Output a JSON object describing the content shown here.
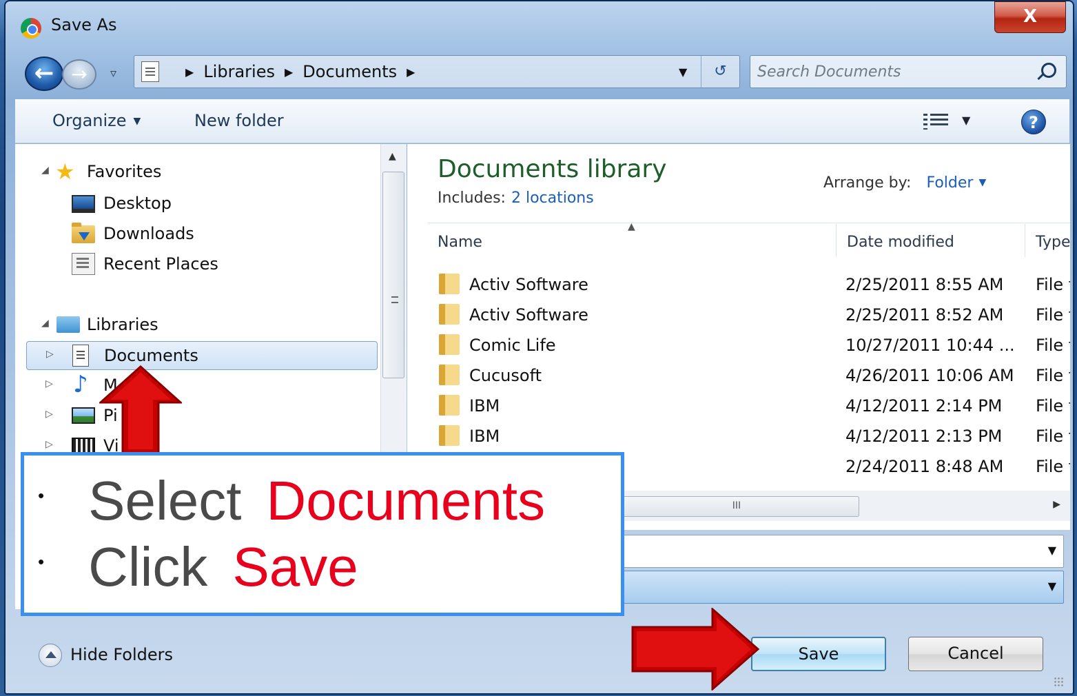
{
  "window": {
    "title": "Save As",
    "close_label": "X"
  },
  "address": {
    "crumbs": [
      "Libraries",
      "Documents"
    ],
    "search_placeholder": "Search Documents"
  },
  "toolbar": {
    "organize": "Organize",
    "new_folder": "New folder",
    "help": "?"
  },
  "nav": {
    "favorites_label": "Favorites",
    "favorites": [
      "Desktop",
      "Downloads",
      "Recent Places"
    ],
    "libraries_label": "Libraries",
    "libraries": [
      "Documents",
      "M",
      "Pi",
      "Vi"
    ]
  },
  "library": {
    "title": "Documents library",
    "includes_label": "Includes:",
    "includes_link": "2 locations",
    "arrange_label": "Arrange by:",
    "arrange_value": "Folder"
  },
  "columns": {
    "name": "Name",
    "date": "Date modified",
    "type": "Type"
  },
  "files": [
    {
      "name": "Activ Software",
      "date": "2/25/2011 8:55 AM",
      "type": "File f"
    },
    {
      "name": "Activ Software",
      "date": "2/25/2011 8:52 AM",
      "type": "File f"
    },
    {
      "name": "Comic Life",
      "date": "10/27/2011 10:44 ...",
      "type": "File f"
    },
    {
      "name": "Cucusoft",
      "date": "4/26/2011 10:06 AM",
      "type": "File f"
    },
    {
      "name": "IBM",
      "date": "4/12/2011 2:14 PM",
      "type": "File f"
    },
    {
      "name": "IBM",
      "date": "4/12/2011 2:13 PM",
      "type": "File f"
    },
    {
      "name": "",
      "date": "2/24/2011 8:48 AM",
      "type": "File f"
    }
  ],
  "footer": {
    "hide_folders": "Hide Folders",
    "save": "Save",
    "cancel": "Cancel"
  },
  "annotation": {
    "line1_prefix": "Select",
    "line1_highlight": "Documents",
    "line2_prefix": "Click",
    "line2_highlight": "Save",
    "bullet": "•",
    "highlight_color": "#e8001c",
    "arrow_color": "#c40000"
  },
  "scroll": {
    "hthumb_grip": "III"
  }
}
